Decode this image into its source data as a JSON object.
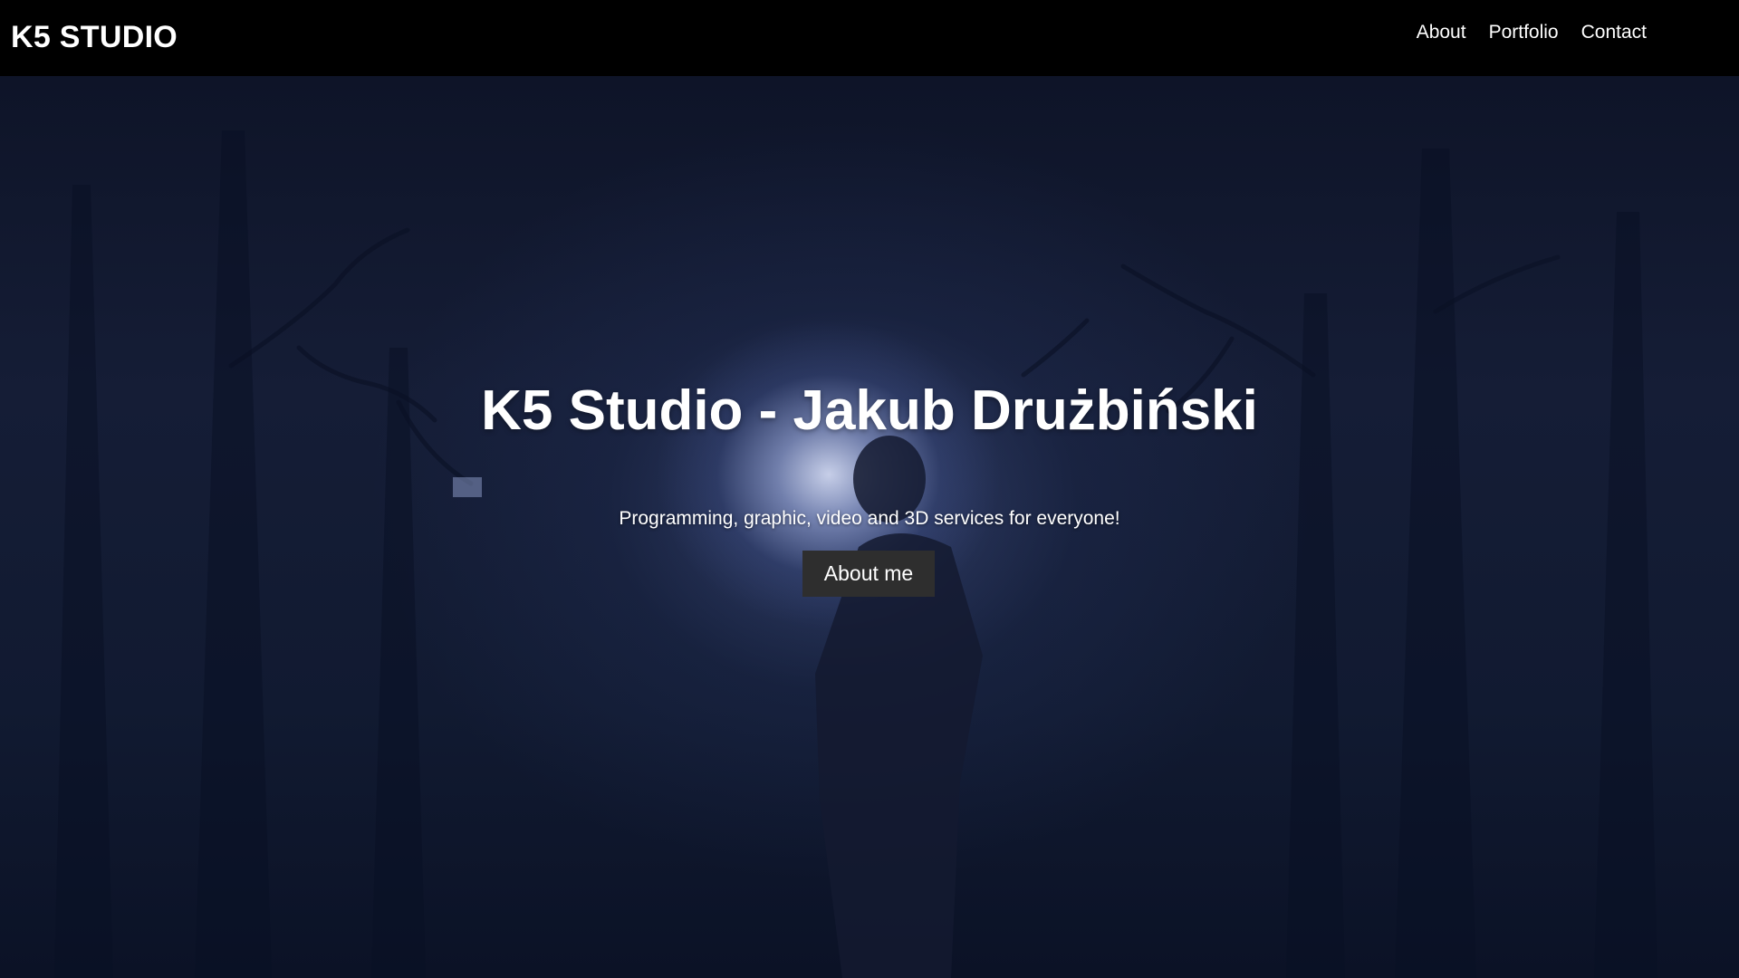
{
  "header": {
    "brand": "K5 STUDIO",
    "nav": {
      "about": "About",
      "portfolio": "Portfolio",
      "contact": "Contact"
    }
  },
  "hero": {
    "title": "K5 Studio - Jakub Drużbiński",
    "subtitle": "Programming, graphic, video and 3D services for everyone!",
    "button_label": "About me"
  },
  "colors": {
    "header_background": "#000000",
    "hero_background": "#151d36",
    "button_background": "#2e2e2e",
    "text": "#ffffff"
  }
}
